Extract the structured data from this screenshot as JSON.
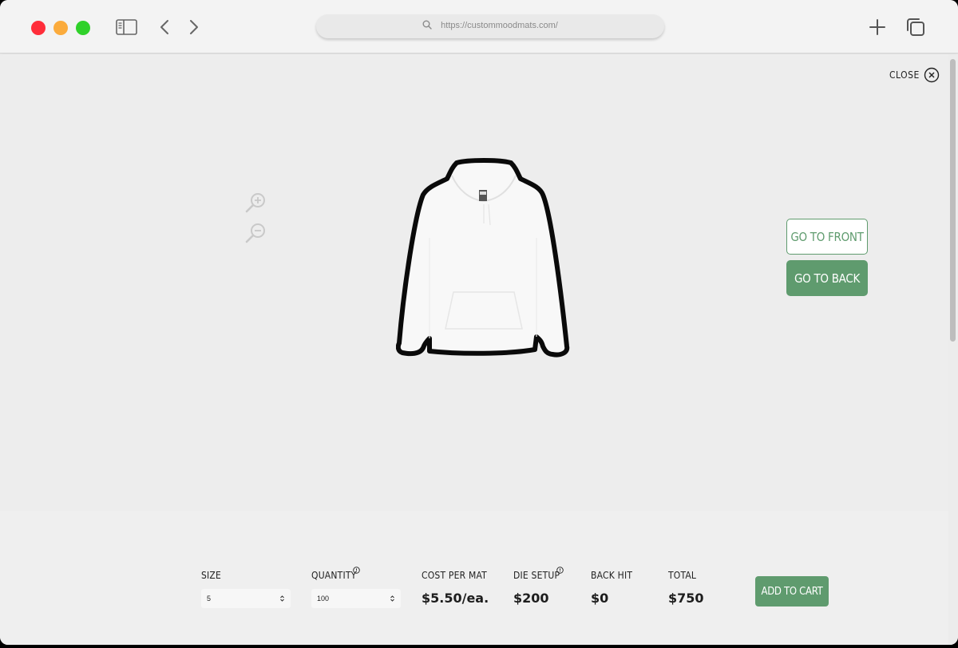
{
  "browser": {
    "url": "https://custommoodmats.com/"
  },
  "modal": {
    "close_label": "CLOSE",
    "go_front_label": "GO TO FRONT",
    "go_back_label": "GO TO BACK",
    "product_image": "white-hoodie"
  },
  "order": {
    "size": {
      "label": "SIZE",
      "value": "5"
    },
    "quantity": {
      "label": "QUANTITY",
      "value": "100"
    },
    "cost_per_mat": {
      "label": "COST PER MAT",
      "value": "$5.50/ea."
    },
    "die_setup": {
      "label": "DIE SETUP",
      "value": "$200"
    },
    "back_hit": {
      "label": "BACK HIT",
      "value": "$0"
    },
    "total": {
      "label": "TOTAL",
      "value": "$750"
    },
    "add_to_cart_label": "ADD TO CART"
  },
  "colors": {
    "accent_green": "#5f9b6e",
    "close_red": "#ff2d3a",
    "minimize_yellow": "#fbab3c",
    "maximize_green": "#2fd12a"
  },
  "icons": [
    "sidebar-icon",
    "back-arrow-icon",
    "forward-arrow-icon",
    "search-icon",
    "new-tab-icon",
    "tabs-overview-icon",
    "close-circle-icon",
    "zoom-in-icon",
    "zoom-out-icon",
    "info-icon",
    "select-arrows-icon"
  ]
}
